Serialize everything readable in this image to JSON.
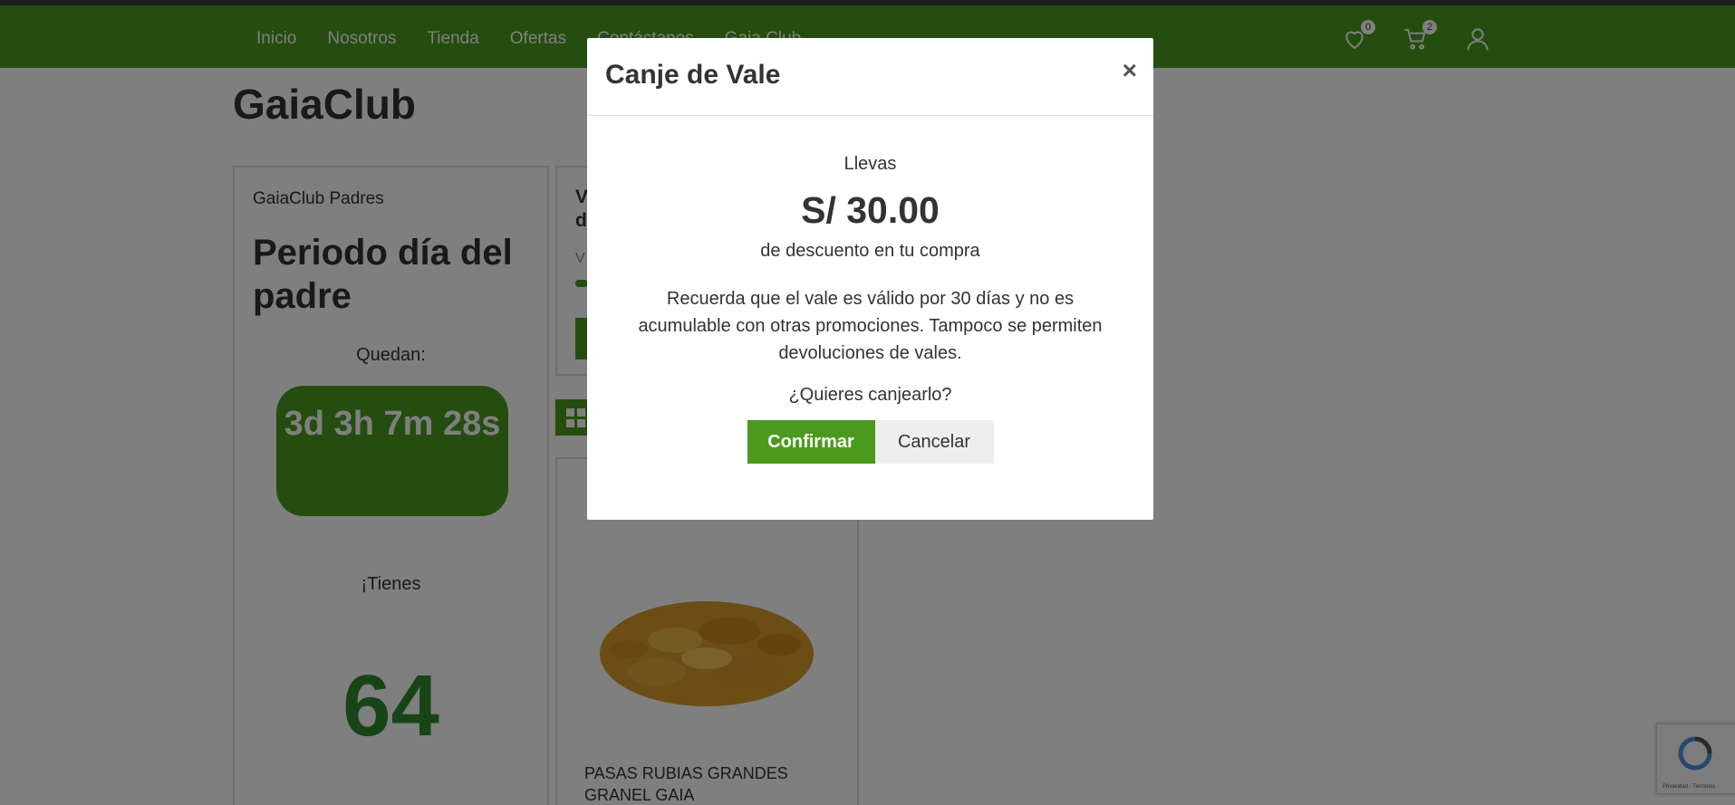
{
  "nav": {
    "links": [
      "Inicio",
      "Nosotros",
      "Tienda",
      "Ofertas",
      "Contáctanos",
      "Gaia Club"
    ],
    "wishlist_count": "0",
    "cart_count": "2"
  },
  "page": {
    "title": "GaiaClub",
    "left_card": {
      "subtitle": "GaiaClub Padres",
      "period": "Periodo día del padre",
      "quedan": "Quedan:",
      "timer": "3d 3h 7m 28s",
      "tienes": "¡Tienes",
      "points": "64"
    },
    "mid_card": {
      "title": "V\nd",
      "sub": "V",
      "progress": 0.05
    },
    "product": {
      "name": "PASAS RUBIAS GRANDES GRANEL GAIA"
    }
  },
  "modal": {
    "title": "Canje de Vale",
    "close": "×",
    "llevas": "Llevas",
    "amount": "S/ 30.00",
    "desc": "de descuento en tu compra",
    "note": "Recuerda que el vale es válido por 30 días y no es acumulable con otras promociones. Tampoco se permiten devoluciones de vales.",
    "question": "¿Quieres canjearlo?",
    "confirm": "Confirmar",
    "cancel": "Cancelar"
  },
  "recaptcha": {
    "footer": "Privacidad - Términos"
  },
  "colors": {
    "brand_green": "#4a9a1f",
    "points_green": "#2e8b2e"
  }
}
